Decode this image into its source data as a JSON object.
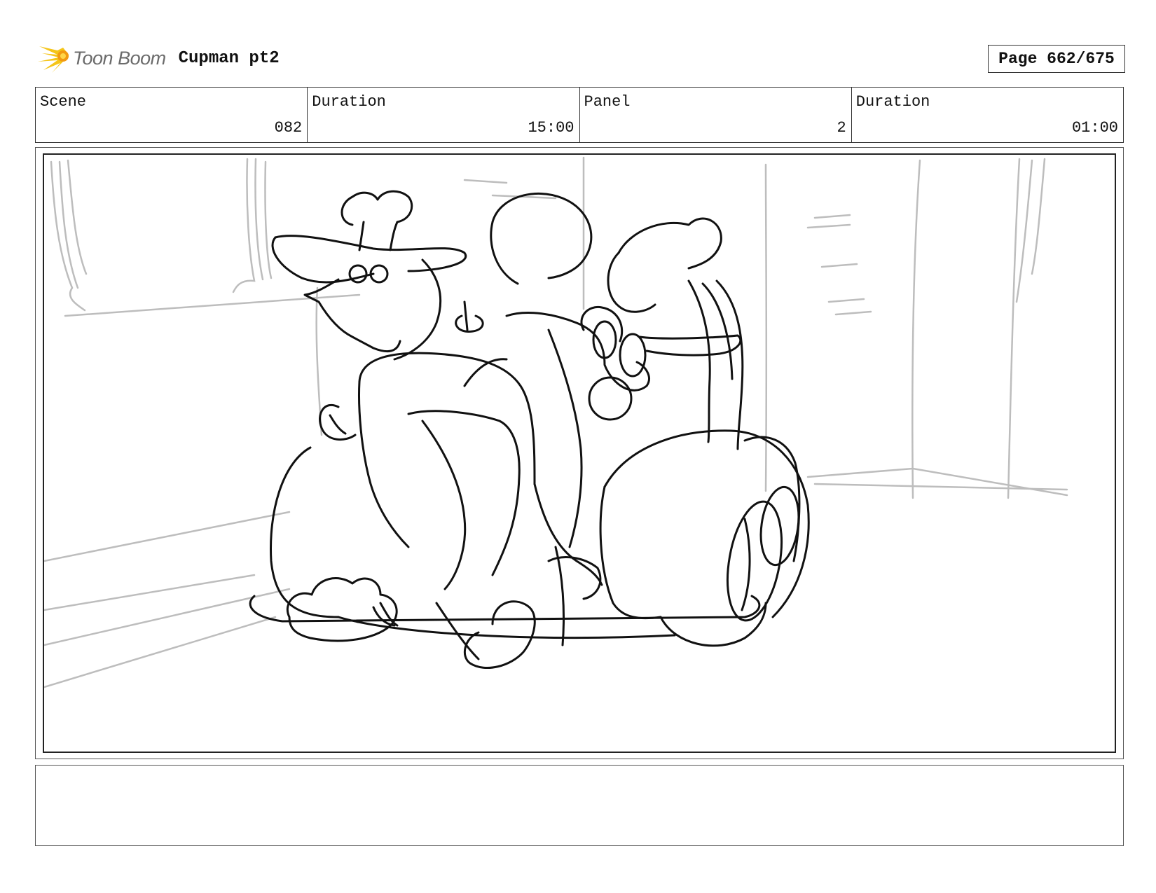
{
  "header": {
    "logo_text": "Toon Boom",
    "project_title": "Cupman pt2",
    "page_label": "Page 662/675"
  },
  "info": {
    "scene_label": "Scene",
    "scene_value": "082",
    "scene_duration_label": "Duration",
    "scene_duration_value": "15:00",
    "panel_label": "Panel",
    "panel_value": "2",
    "panel_duration_label": "Duration",
    "panel_duration_value": "01:00"
  },
  "caption": {
    "text": ""
  },
  "colors": {
    "logo_yellow": "#f5c518",
    "logo_orange": "#f29a12",
    "sketch_line": "#111111",
    "background_line": "#bdbdbd"
  },
  "icons": {
    "logo": "toon-boom-burst-logo"
  }
}
